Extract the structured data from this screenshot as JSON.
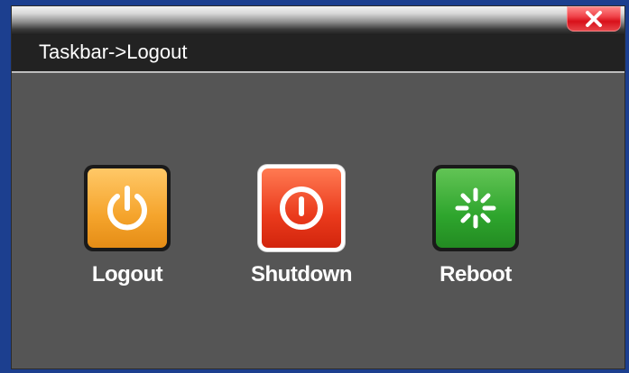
{
  "window": {
    "title": "Taskbar->Logout",
    "close_icon": "close-x-icon"
  },
  "actions": [
    {
      "label": "Logout",
      "icon": "power-icon",
      "color": "#f5a42c",
      "selected": false
    },
    {
      "label": "Shutdown",
      "icon": "shutdown-icon",
      "color": "#ea3a1c",
      "selected": true
    },
    {
      "label": "Reboot",
      "icon": "reboot-spinner-icon",
      "color": "#2ea52d",
      "selected": false
    }
  ]
}
